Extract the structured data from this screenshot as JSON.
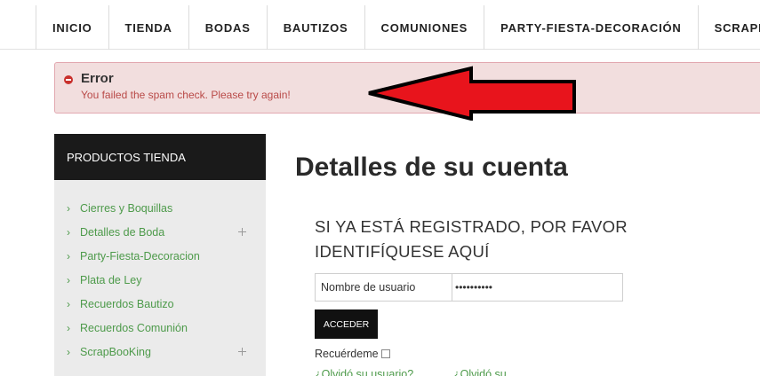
{
  "nav": {
    "items": [
      "INICIO",
      "TIENDA",
      "BODAS",
      "BAUTIZOS",
      "COMUNIONES",
      "PARTY-FIESTA-DECORACIÓN",
      "SCRAPBO"
    ]
  },
  "alert": {
    "title": "Error",
    "message": "You failed the spam check. Please try again!"
  },
  "sidebar": {
    "heading": "PRODUCTOS TIENDA",
    "items": [
      {
        "label": "Cierres y Boquillas",
        "expandable": false
      },
      {
        "label": "Detalles de Boda",
        "expandable": true
      },
      {
        "label": "Party-Fiesta-Decoracion",
        "expandable": false
      },
      {
        "label": "Plata de Ley",
        "expandable": false
      },
      {
        "label": "Recuerdos Bautizo",
        "expandable": false
      },
      {
        "label": "Recuerdos Comunión",
        "expandable": false
      },
      {
        "label": "ScrapBooKing",
        "expandable": true
      }
    ]
  },
  "main": {
    "title": "Detalles de su cuenta",
    "login_heading": "SI YA ESTÁ REGISTRADO, POR FAVOR IDENTIFÍQUESE AQUÍ",
    "username_placeholder": "Nombre de usuario",
    "password_value": "••••••••••",
    "submit_label": "ACCEDER",
    "remember_label": "Recuérdeme",
    "remember_checked": false,
    "forgot_username": "¿Olvidó su usuario?",
    "forgot_password": "¿Olvidó su"
  },
  "colors": {
    "alert_bg": "#f2dede",
    "alert_text": "#b94a48",
    "link_green": "#4d9a4a",
    "arrow_red": "#e8141c"
  }
}
